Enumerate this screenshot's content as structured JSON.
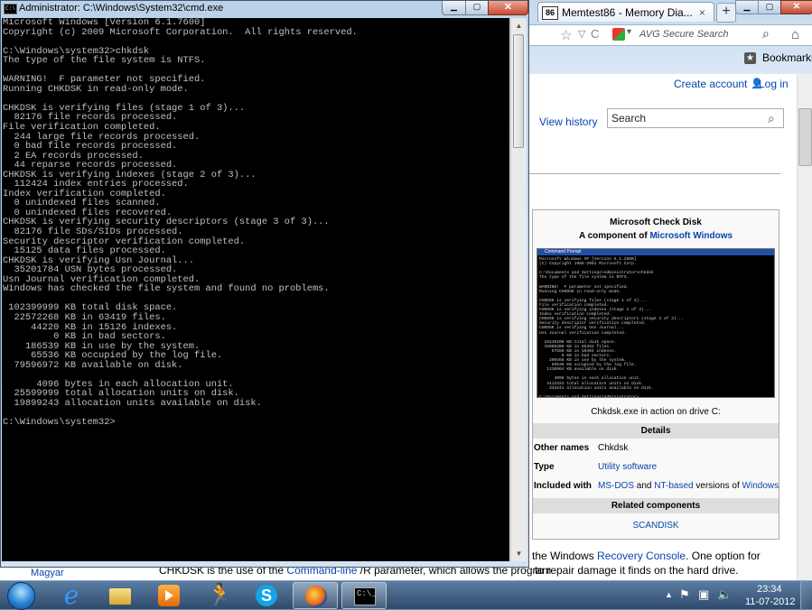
{
  "cmd": {
    "title": "Administrator: C:\\Windows\\System32\\cmd.exe",
    "icon_text": "C:\\",
    "minimize": "▁",
    "maximize": "▢",
    "close": "✕",
    "scroll_up": "▲",
    "scroll_down": "▼",
    "console_lines": [
      "Microsoft Windows [Version 6.1.7600]",
      "Copyright (c) 2009 Microsoft Corporation.  All rights reserved.",
      "",
      "C:\\Windows\\system32>chkdsk",
      "The type of the file system is NTFS.",
      "",
      "WARNING!  F parameter not specified.",
      "Running CHKDSK in read-only mode.",
      "",
      "CHKDSK is verifying files (stage 1 of 3)...",
      "  82176 file records processed.",
      "File verification completed.",
      "  244 large file records processed.",
      "  0 bad file records processed.",
      "  2 EA records processed.",
      "  44 reparse records processed.",
      "CHKDSK is verifying indexes (stage 2 of 3)...",
      "  112424 index entries processed.",
      "Index verification completed.",
      "  0 unindexed files scanned.",
      "  0 unindexed files recovered.",
      "CHKDSK is verifying security descriptors (stage 3 of 3)...",
      "  82176 file SDs/SIDs processed.",
      "Security descriptor verification completed.",
      "  15125 data files processed.",
      "CHKDSK is verifying Usn Journal...",
      "  35201784 USN bytes processed.",
      "Usn Journal verification completed.",
      "Windows has checked the file system and found no problems.",
      "",
      " 102399999 KB total disk space.",
      "  22572268 KB in 63419 files.",
      "     44220 KB in 15126 indexes.",
      "         0 KB in bad sectors.",
      "    186539 KB in use by the system.",
      "     65536 KB occupied by the log file.",
      "  79596972 KB available on disk.",
      "",
      "      4096 bytes in each allocation unit.",
      "  25599999 total allocation units on disk.",
      "  19899243 allocation units available on disk.",
      "",
      "C:\\Windows\\system32>"
    ]
  },
  "browser": {
    "tab_icon": "86",
    "tab_title": "Memtest86 - Memory Dia...",
    "tab_close": "×",
    "new_tab": "+",
    "minimize": "▁",
    "maximize": "▢",
    "close": "✕",
    "star": "☆",
    "nav_dropdown": "▽",
    "refresh": "C",
    "avg_dropdown": "▾",
    "avg_placeholder": "AVG Secure Search",
    "search_glyph": "⌕",
    "home": "⌂",
    "bookmarks_glyph": "★",
    "bookmarks_label": "Bookmarks"
  },
  "wiki": {
    "create_account": "Create account",
    "user_glyph": "👤",
    "log_in": "Log in",
    "view_history": "View history",
    "search_placeholder": "Search",
    "search_glyph": "⌕",
    "infobox": {
      "title": "Microsoft Check Disk",
      "subtitle_prefix": "A component of ",
      "subtitle_link": "Microsoft Windows",
      "screenshot_title": "Command Prompt",
      "screenshot_lines": [
        "Microsoft Windows XP [Version 5.1.2600]",
        "(C) Copyright 1985-2001 Microsoft Corp.",
        "",
        "C:\\Documents and Settings\\Administrator>chkdsk",
        "The type of the file system is NTFS.",
        "",
        "WARNING!  F parameter not specified.",
        "Running CHKDSK in read-only mode.",
        "",
        "CHKDSK is verifying files (stage 1 of 3)...",
        "File verification completed.",
        "CHKDSK is verifying indexes (stage 2 of 3)...",
        "Index verification completed.",
        "CHKDSK is verifying security descriptors (stage 3 of 3)...",
        "Security descriptor verification completed.",
        "CHKDSK is verifying Usn Journal...",
        "Usn Journal verification completed.",
        "",
        "  16449200 KB total disk space.",
        "  15005300 KB in 85352 files.",
        "     57556 KB in 10404 indexes.",
        "         0 KB in bad sectors.",
        "    209468 KB in use by the system.",
        "     65536 KB occupied by the log file.",
        "   1336964 KB available on disk.",
        "",
        "      4096 bytes in each allocation unit.",
        "   4112322 total allocation units on disk.",
        "    334241 allocation units available on disk.",
        "",
        "C:\\Documents and Settings\\Administrator>"
      ],
      "caption": "Chkdsk.exe in action on drive C:",
      "details_header": "Details",
      "other_names_label": "Other names",
      "other_names_value": "Chkdsk",
      "type_label": "Type",
      "type_value": "Utility software",
      "included_label": "Included with",
      "included_link_1": "MS-DOS",
      "included_and": " and ",
      "included_link_2": "NT-based",
      "included_middle": " versions of ",
      "included_link_3": "Windows",
      "related_header": "Related components",
      "related_item": "SCANDISK"
    },
    "para1_prefix": "the Windows ",
    "para1_link": "Recovery Console",
    "para1_suffix": ". One option for",
    "magyar": "Magyar",
    "para2_prefix": "CHKDSK is the use of the ",
    "para2_link": "Command-line",
    "para2_mid": " /R parameter, which allows the program",
    "para2_rest": "to repair damage it finds on the hard drive."
  },
  "taskbar": {
    "cmd_glyph": "C:\\_",
    "runner_glyph": "🏃",
    "skype_glyph": "S",
    "ie_glyph": "e",
    "tray_show_hidden": "▲",
    "tray_flag": "⚑",
    "tray_network": "▣",
    "tray_volume": "🔈",
    "clock_time": "23:34",
    "clock_date": "11-07-2012"
  }
}
